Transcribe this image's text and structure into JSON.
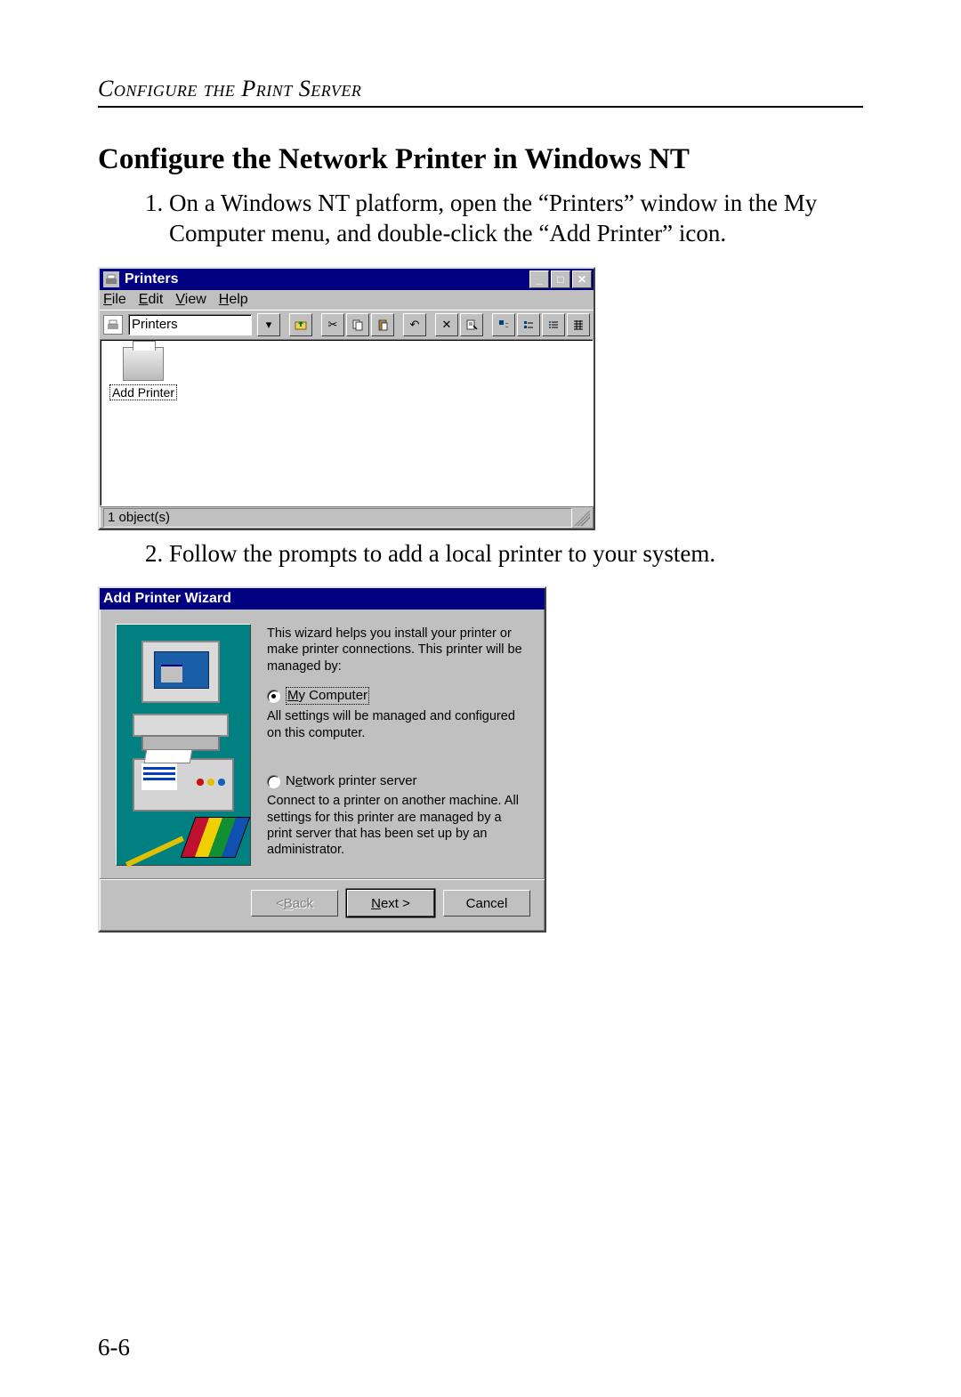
{
  "doc": {
    "header": "Configure the Print Server",
    "title": "Configure the Network Printer in Windows NT",
    "step1": "On a Windows NT platform, open the “Printers” window in the My Computer menu, and double-click the “Add Printer” icon.",
    "step2": "Follow the prompts to add a local printer to your system.",
    "page_number": "6-6"
  },
  "printersWindow": {
    "title": "Printers",
    "menus": {
      "file": "File",
      "edit": "Edit",
      "view": "View",
      "help": "Help"
    },
    "address_label": "Printers",
    "icon_label": "Add Printer",
    "status": "1 object(s)",
    "toolbar_icons": {
      "dropdown": "▾",
      "up": "⬆",
      "cut": "✂",
      "copy": "⧉",
      "paste": "ὌB",
      "undo": "↶",
      "delete": "✕",
      "properties": "⚙",
      "large": "▣",
      "small": "▪",
      "list": "≡",
      "details": "☷"
    },
    "sysbuttons": {
      "min": "_",
      "max": "□",
      "close": "✕"
    }
  },
  "wizard": {
    "title": "Add Printer Wizard",
    "intro": "This wizard helps you install your printer or make printer connections.  This printer will be managed by:",
    "opt1_label": "My Computer",
    "opt1_desc": "All settings will be managed and configured on this computer.",
    "opt2_label": "Network printer server",
    "opt2_desc": "Connect to a printer on another machine.  All settings for this printer are managed by a print server that has been set up by an administrator.",
    "buttons": {
      "back": "< Back",
      "next": "Next >",
      "cancel": "Cancel"
    }
  }
}
